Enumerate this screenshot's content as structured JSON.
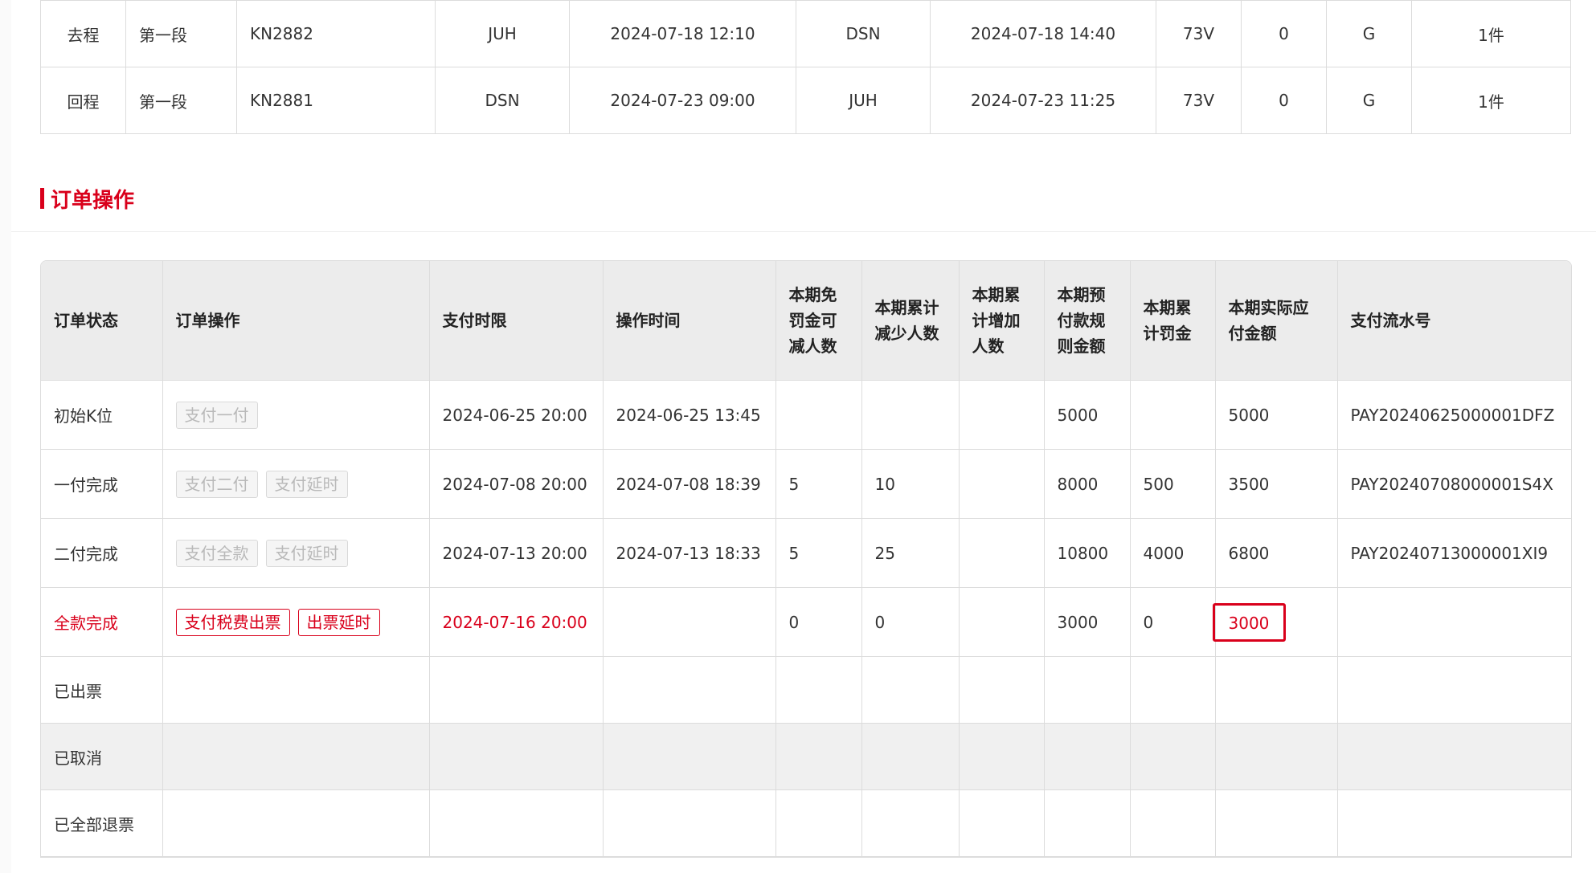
{
  "flights": [
    {
      "direction": "去程",
      "segment": "第一段",
      "flight_no": "KN2882",
      "dep_airport": "JUH",
      "dep_time": "2024-07-18 12:10",
      "arr_airport": "DSN",
      "arr_time": "2024-07-18 14:40",
      "aircraft": "73V",
      "stops": "0",
      "cabin": "G",
      "baggage": "1件"
    },
    {
      "direction": "回程",
      "segment": "第一段",
      "flight_no": "KN2881",
      "dep_airport": "DSN",
      "dep_time": "2024-07-23 09:00",
      "arr_airport": "JUH",
      "arr_time": "2024-07-23 11:25",
      "aircraft": "73V",
      "stops": "0",
      "cabin": "G",
      "baggage": "1件"
    }
  ],
  "section_title": "订单操作",
  "order_table": {
    "headers": {
      "status": "订单状态",
      "operation": "订单操作",
      "deadline": "支付时限",
      "op_time": "操作时间",
      "free_reduce": [
        "本期免",
        "罚金可",
        "减人数"
      ],
      "cum_reduce": [
        "本期累计",
        "减少人数"
      ],
      "cum_add": [
        "本期累",
        "计增加",
        "人数"
      ],
      "prepay_rule": [
        "本期预",
        "付款规",
        "则金额"
      ],
      "cum_penalty": [
        "本期累",
        "计罚金"
      ],
      "actual_pay": [
        "本期实际应",
        "付金额"
      ],
      "serial": "支付流水号"
    },
    "rows": [
      {
        "status": "初始K位",
        "buttons": [
          "支付一付"
        ],
        "deadline": "2024-06-25 20:00",
        "op_time": "2024-06-25 13:45",
        "free_reduce": "",
        "cum_reduce": "",
        "cum_add": "",
        "prepay_rule": "5000",
        "cum_penalty": "",
        "actual_pay": "5000",
        "serial": "PAY20240625000001DFZ"
      },
      {
        "status": "一付完成",
        "buttons": [
          "支付二付",
          "支付延时"
        ],
        "deadline": "2024-07-08 20:00",
        "op_time": "2024-07-08 18:39",
        "free_reduce": "5",
        "cum_reduce": "10",
        "cum_add": "",
        "prepay_rule": "8000",
        "cum_penalty": "500",
        "actual_pay": "3500",
        "serial": "PAY20240708000001S4X"
      },
      {
        "status": "二付完成",
        "buttons": [
          "支付全款",
          "支付延时"
        ],
        "deadline": "2024-07-13 20:00",
        "op_time": "2024-07-13 18:33",
        "free_reduce": "5",
        "cum_reduce": "25",
        "cum_add": "",
        "prepay_rule": "10800",
        "cum_penalty": "4000",
        "actual_pay": "6800",
        "serial": "PAY20240713000001XI9"
      },
      {
        "status": "全款完成",
        "buttons": [
          "支付税费出票",
          "出票延时"
        ],
        "deadline": "2024-07-16 20:00",
        "op_time": "",
        "free_reduce": "0",
        "cum_reduce": "0",
        "cum_add": "",
        "prepay_rule": "3000",
        "cum_penalty": "0",
        "actual_pay": "3000",
        "serial": ""
      },
      {
        "status": "已出票"
      },
      {
        "status": "已取消"
      },
      {
        "status": "已全部退票"
      }
    ]
  },
  "colors": {
    "accent": "#d9001b",
    "header_bg": "#ececec",
    "border": "#dcdcdc"
  }
}
